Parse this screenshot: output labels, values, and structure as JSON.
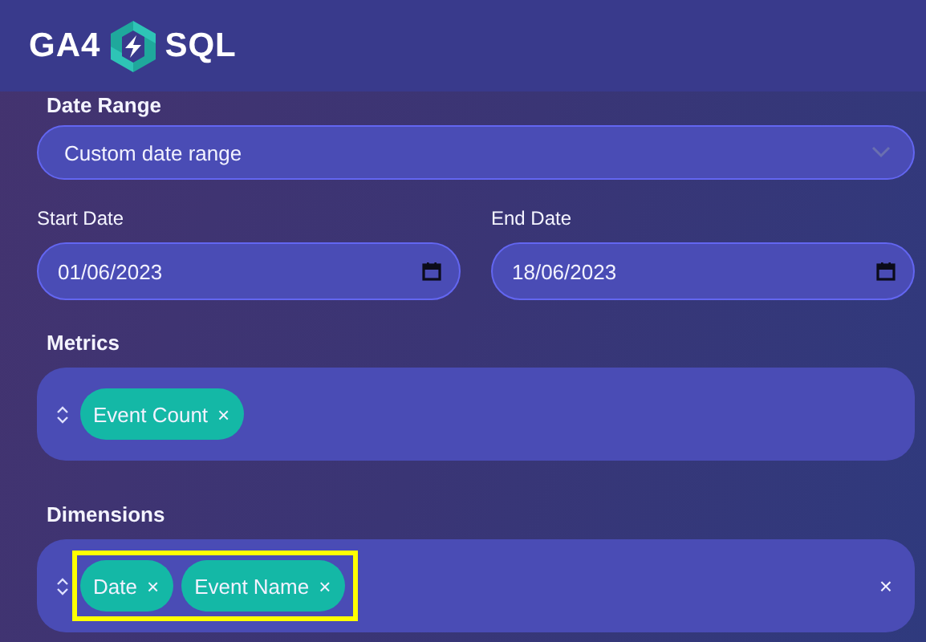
{
  "header": {
    "logo_left": "GA4",
    "logo_right": "SQL"
  },
  "date_range": {
    "label": "Date Range",
    "value": "Custom date range"
  },
  "start_date": {
    "label": "Start Date",
    "value": "01/06/2023"
  },
  "end_date": {
    "label": "End Date",
    "value": "18/06/2023"
  },
  "metrics": {
    "label": "Metrics",
    "highlighted": false,
    "chips": [
      {
        "label": "Event Count",
        "remove": "×"
      }
    ]
  },
  "dimensions": {
    "label": "Dimensions",
    "highlighted": true,
    "clear": "×",
    "chips": [
      {
        "label": "Date",
        "remove": "×"
      },
      {
        "label": "Event Name",
        "remove": "×"
      }
    ]
  }
}
